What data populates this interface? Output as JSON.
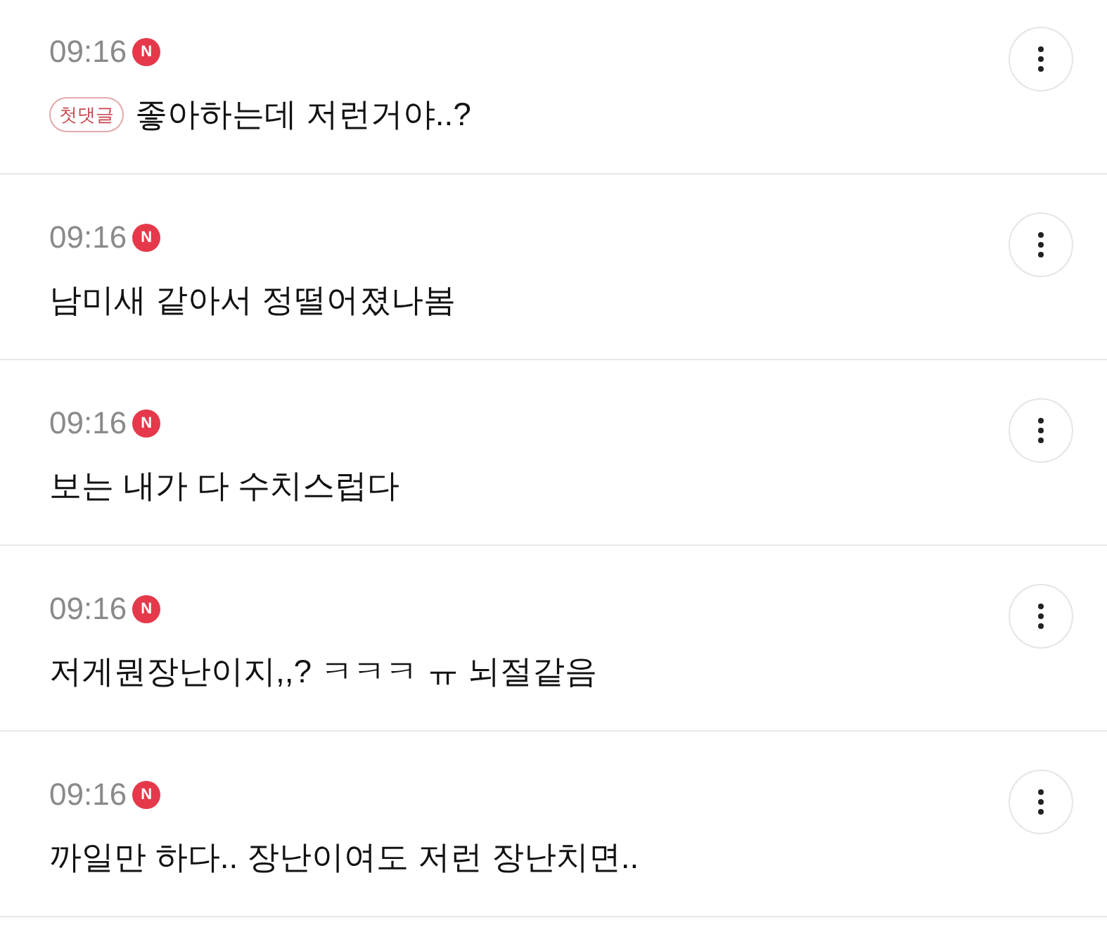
{
  "comments": [
    {
      "time": "09:16",
      "new_badge": "N",
      "tag": "첫댓글",
      "text": "좋아하는데 저런거야..?"
    },
    {
      "time": "09:16",
      "new_badge": "N",
      "text": "남미새 같아서 정떨어졌나봄"
    },
    {
      "time": "09:16",
      "new_badge": "N",
      "text": "보는 내가 다 수치스럽다"
    },
    {
      "time": "09:16",
      "new_badge": "N",
      "text": "저게뭔장난이지,,? ㅋㅋㅋ ㅠ 뇌절같음"
    },
    {
      "time": "09:16",
      "new_badge": "N",
      "text": "까일만 하다.. 장난이여도 저런 장난치면.."
    }
  ]
}
